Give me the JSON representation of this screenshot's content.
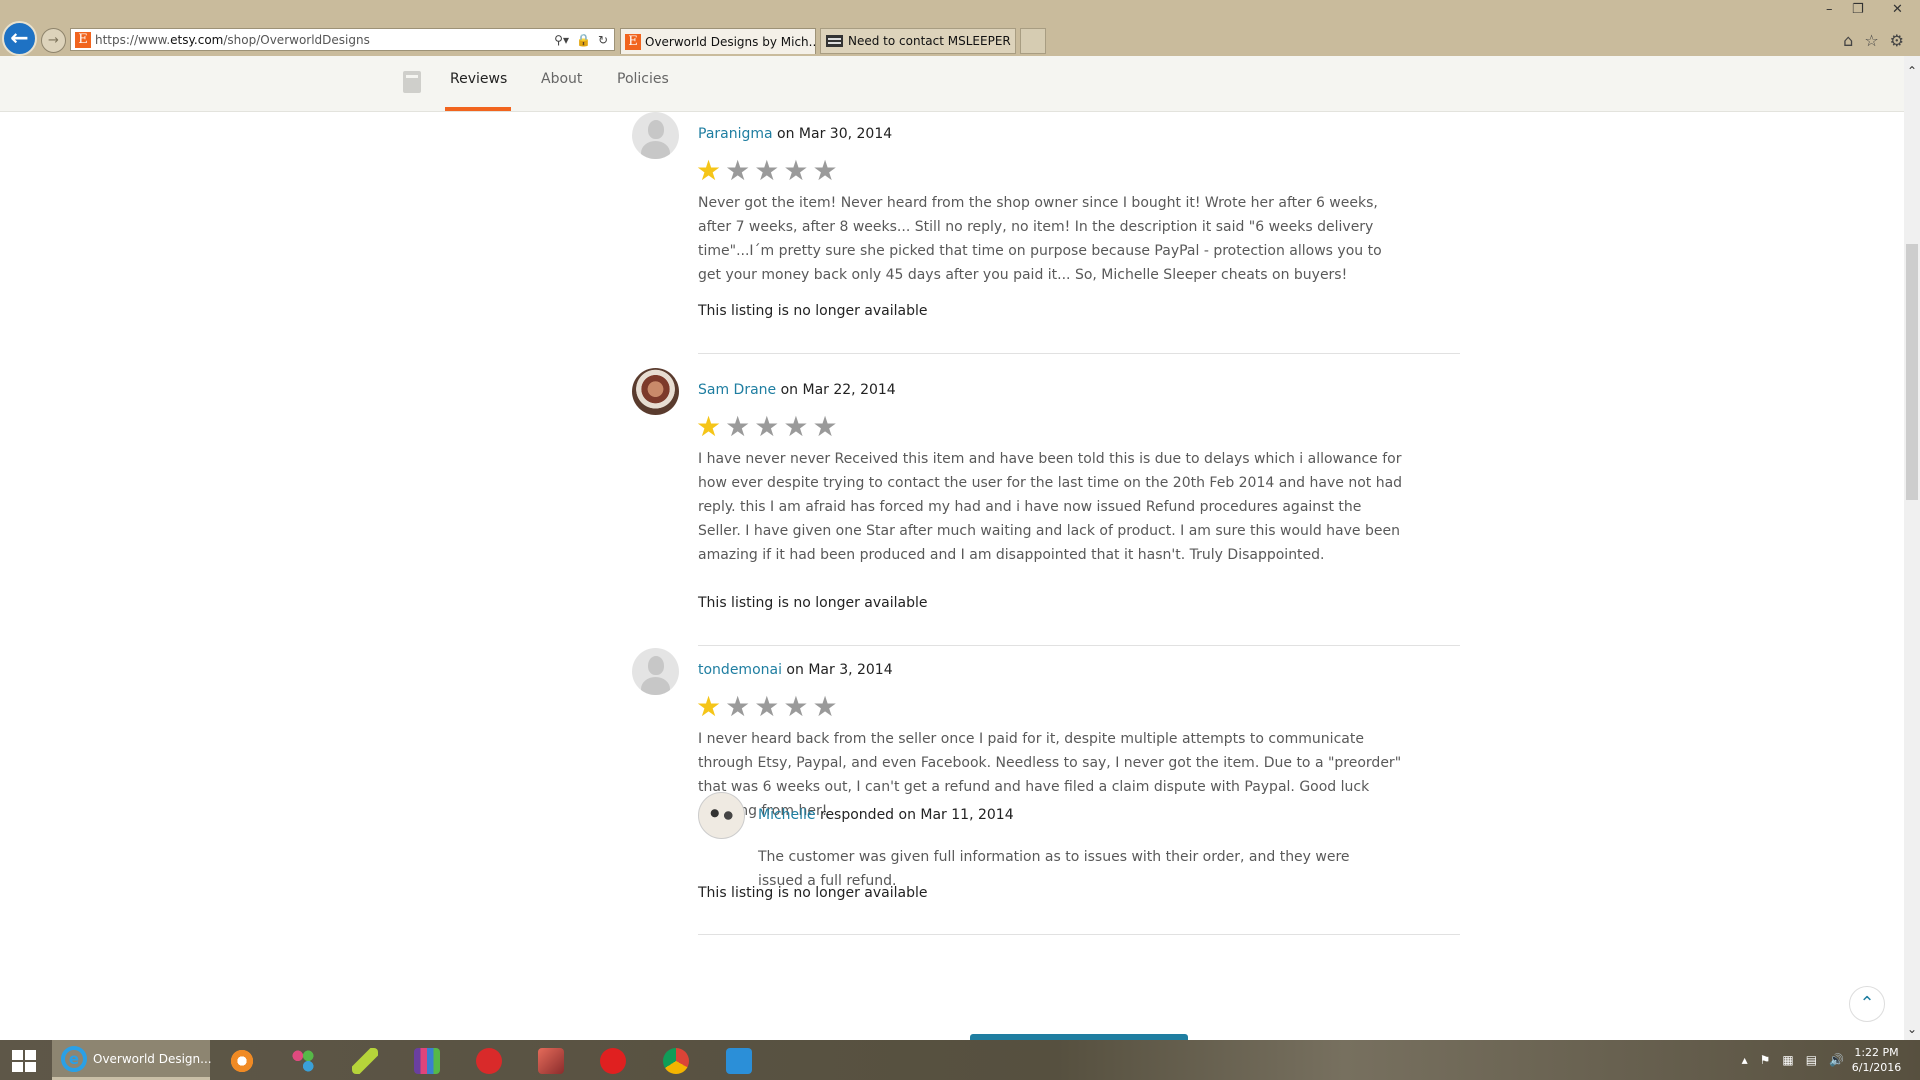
{
  "browser": {
    "url_prefix": "https://www.",
    "url_domain": "etsy.com",
    "url_path": "/shop/OverworldDesigns",
    "tabs": [
      {
        "label": "Overworld Designs by Mich...",
        "active": true
      },
      {
        "label": "Need to contact MSLEEPER - K...",
        "active": false
      }
    ],
    "icons": [
      "back-icon",
      "forward-icon",
      "search-icon",
      "lock-icon",
      "refresh-icon",
      "home-icon",
      "favorites-star-icon",
      "settings-gear-icon"
    ]
  },
  "shop_nav": {
    "tabs": [
      "Reviews",
      "About",
      "Policies"
    ],
    "active": "Reviews",
    "accent_color": "#f1641e"
  },
  "reviews": [
    {
      "reviewer": "Paranigma",
      "date_text": " on Mar 30, 2014",
      "rating": 1,
      "max_rating": 5,
      "body": "Never got the item! Never heard from the shop owner since I bought it! Wrote her after 6 weeks, after 7 weeks, after 8 weeks... Still no reply, no item! In the description it said \"6 weeks delivery time\"...I´m pretty sure she picked that time on purpose because PayPal - protection allows you to get your money back only 45 days after you paid it... So, Michelle Sleeper cheats on buyers!",
      "status": "This listing is no longer available"
    },
    {
      "reviewer": "Sam Drane",
      "date_text": " on Mar 22, 2014",
      "rating": 1,
      "max_rating": 5,
      "body": "I have never never Received this item and have been told this is due to delays which i allowance for how ever despite trying to contact the user for the last time on the 20th Feb 2014 and have not had reply. this I am afraid has forced my had and i have now issued Refund procedures against the Seller. I have given one Star after much waiting and lack of product. I am sure this would have been amazing if it had been produced and I am disappointed that it hasn't. Truly Disappointed.",
      "status": "This listing is no longer available"
    },
    {
      "reviewer": "tondemonai",
      "date_text": " on Mar 3, 2014",
      "rating": 1,
      "max_rating": 5,
      "body": "I never heard back from the seller once I paid for it, despite multiple attempts to communicate through Etsy, Paypal, and even Facebook. Needless to say, I never got the item. Due to a \"preorder\" that was 6 weeks out, I can't get a refund and have filed a claim dispute with Paypal. Good luck ordering from her!",
      "response": {
        "responder": "Michelle",
        "date_text": " responded on Mar 11, 2014",
        "body": "The customer was given full information as to issues with their order, and they were issued a full refund."
      },
      "status": "This listing is no longer available"
    }
  ],
  "taskbar": {
    "active_app_label": "Overworld Design...",
    "clock_time": "1:22 PM",
    "clock_date": "6/1/2016"
  },
  "colors": {
    "link": "#1f7ea1",
    "star_filled": "#f5c518",
    "star_empty": "#9a9a9a"
  }
}
